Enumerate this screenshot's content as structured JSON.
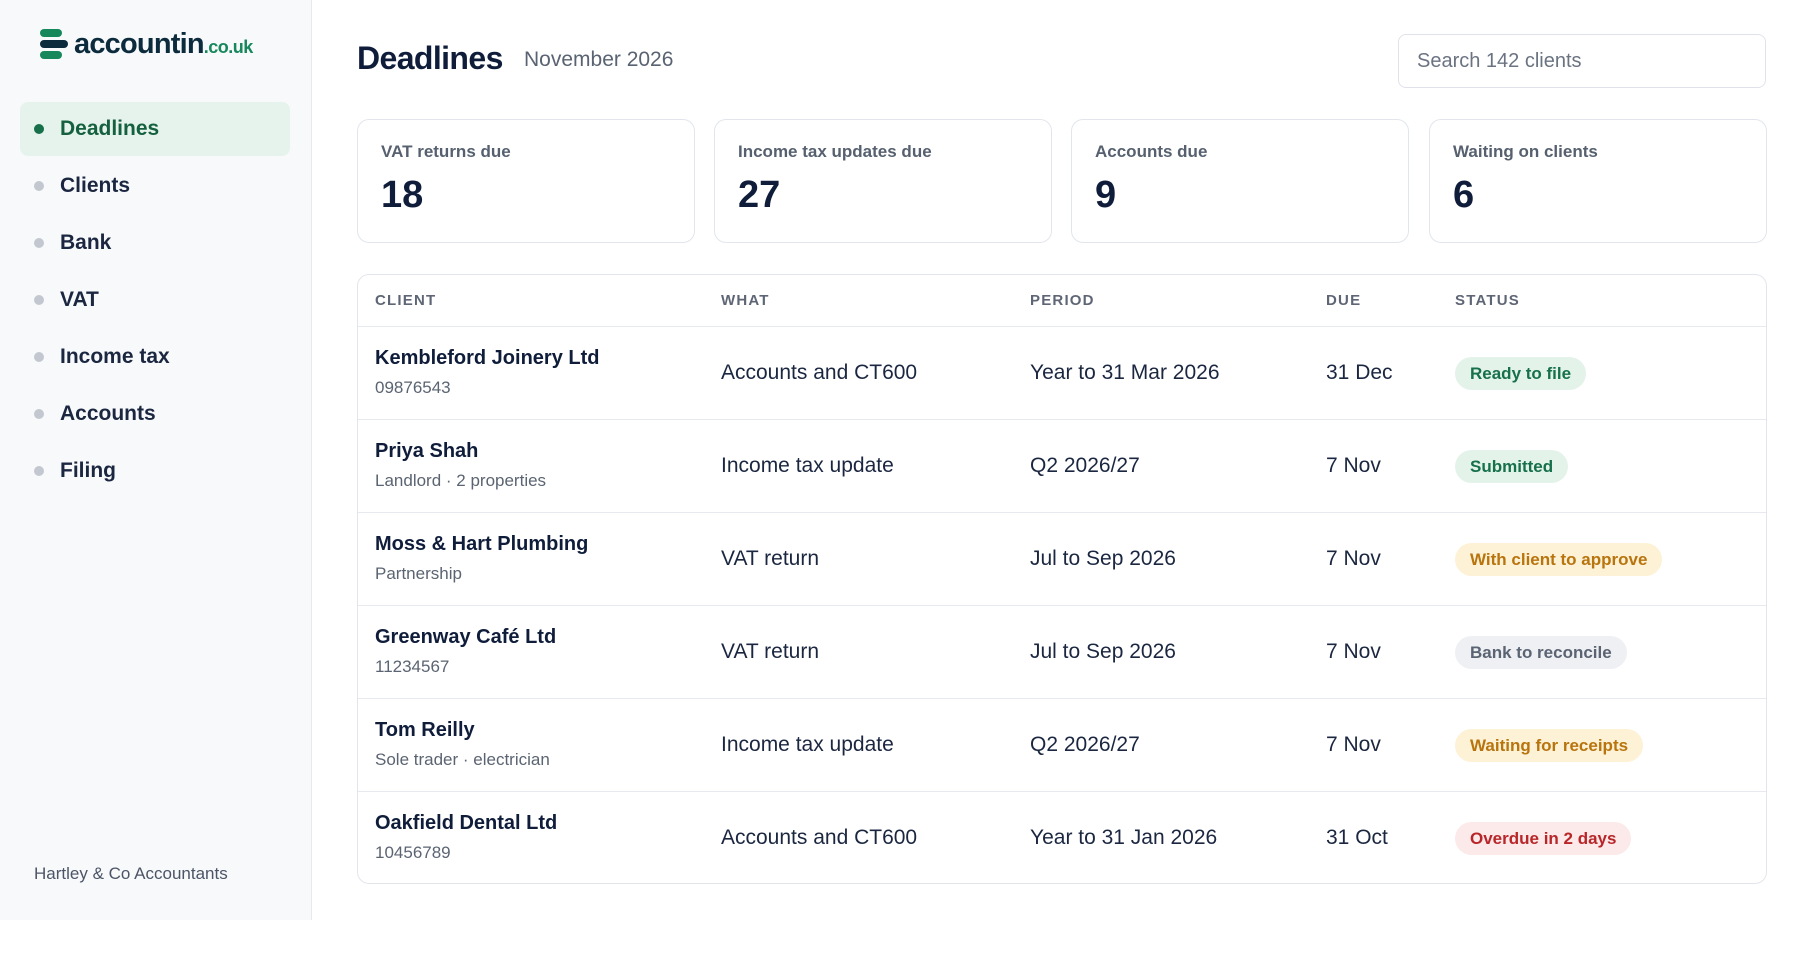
{
  "brand": {
    "name": "accountin",
    "tld": ".co.uk"
  },
  "sidebar": {
    "items": [
      {
        "label": "Deadlines",
        "active": true
      },
      {
        "label": "Clients",
        "active": false
      },
      {
        "label": "Bank",
        "active": false
      },
      {
        "label": "VAT",
        "active": false
      },
      {
        "label": "Income tax",
        "active": false
      },
      {
        "label": "Accounts",
        "active": false
      },
      {
        "label": "Filing",
        "active": false
      }
    ],
    "firm_name": "Hartley & Co Accountants"
  },
  "header": {
    "title": "Deadlines",
    "subtitle": "November 2026",
    "search_placeholder": "Search 142 clients"
  },
  "summary": [
    {
      "label": "VAT returns due",
      "value": "18"
    },
    {
      "label": "Income tax updates due",
      "value": "27"
    },
    {
      "label": "Accounts due",
      "value": "9"
    },
    {
      "label": "Waiting on clients",
      "value": "6"
    }
  ],
  "table": {
    "columns": [
      "CLIENT",
      "WHAT",
      "PERIOD",
      "DUE",
      "STATUS"
    ],
    "rows": [
      {
        "client": "Kembleford Joinery Ltd",
        "detail": "09876543",
        "what": "Accounts and CT600",
        "period": "Year to 31 Mar 2026",
        "due": "31 Dec",
        "status": "Ready to file",
        "tone": "green"
      },
      {
        "client": "Priya Shah",
        "detail": "Landlord · 2 properties",
        "what": "Income tax update",
        "period": "Q2 2026/27",
        "due": "7 Nov",
        "status": "Submitted",
        "tone": "green"
      },
      {
        "client": "Moss & Hart Plumbing",
        "detail": "Partnership",
        "what": "VAT return",
        "period": "Jul to Sep 2026",
        "due": "7 Nov",
        "status": "With client to approve",
        "tone": "amber"
      },
      {
        "client": "Greenway Café Ltd",
        "detail": "11234567",
        "what": "VAT return",
        "period": "Jul to Sep 2026",
        "due": "7 Nov",
        "status": "Bank to reconcile",
        "tone": "grey"
      },
      {
        "client": "Tom Reilly",
        "detail": "Sole trader · electrician",
        "what": "Income tax update",
        "period": "Q2 2026/27",
        "due": "7 Nov",
        "status": "Waiting for receipts",
        "tone": "amber"
      },
      {
        "client": "Oakfield Dental Ltd",
        "detail": "10456789",
        "what": "Accounts and CT600",
        "period": "Year to 31 Jan 2026",
        "due": "31 Oct",
        "status": "Overdue in 2 days",
        "tone": "red"
      }
    ]
  },
  "colors": {
    "brand_green": "#17885c",
    "brand_navy": "#0c2b3c",
    "active_nav_bg": "#e6f3ec",
    "status_green": "#16704a",
    "status_amber": "#b8740d",
    "status_grey": "#5b6473",
    "status_red": "#b8262a"
  }
}
